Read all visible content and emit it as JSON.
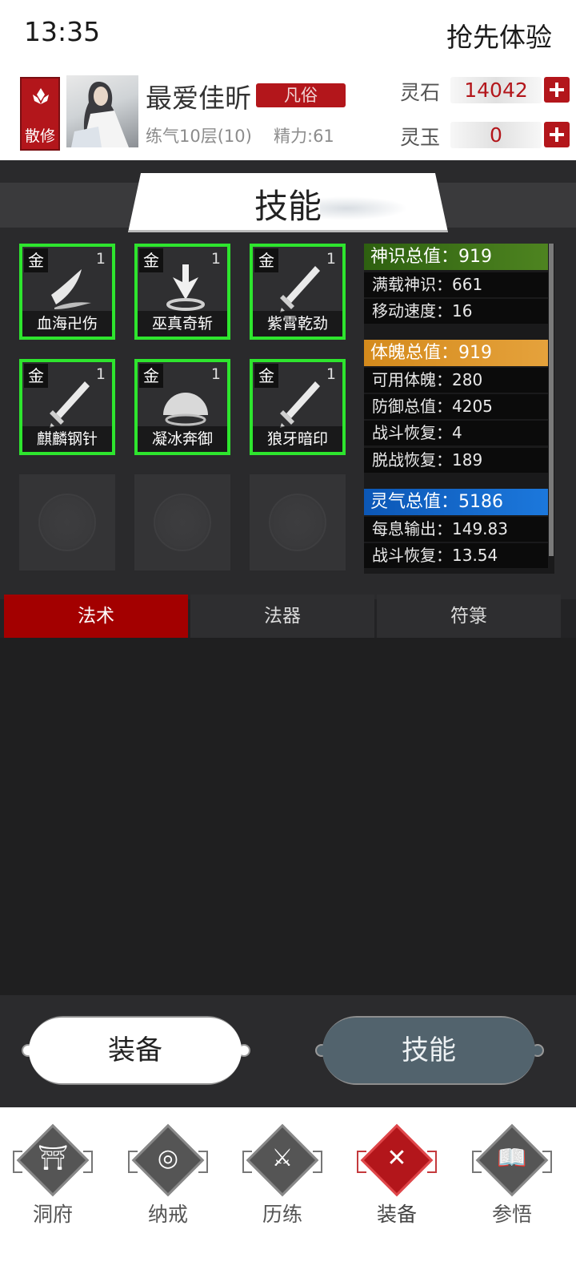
{
  "status": {
    "time": "13:35",
    "action": "抢先体验"
  },
  "player": {
    "sect": "散修",
    "name": "最爱佳昕",
    "rank": "凡俗",
    "realm": "练气10层(10)",
    "energy": "精力:61"
  },
  "currencies": [
    {
      "label": "灵石",
      "value": "14042"
    },
    {
      "label": "灵玉",
      "value": "0"
    }
  ],
  "panel": {
    "title": "技能"
  },
  "skills": [
    {
      "grade": "金",
      "level": "1",
      "name": "血海卍伤",
      "icon": "wave-slash-icon"
    },
    {
      "grade": "金",
      "level": "1",
      "name": "巫真奇斩",
      "icon": "arrow-down-icon"
    },
    {
      "grade": "金",
      "level": "1",
      "name": "紫霄乾劲",
      "icon": "sword-icon"
    },
    {
      "grade": "金",
      "level": "1",
      "name": "麒麟钢针",
      "icon": "sword-icon"
    },
    {
      "grade": "金",
      "level": "1",
      "name": "凝冰奔御",
      "icon": "shield-orb-icon"
    },
    {
      "grade": "金",
      "level": "1",
      "name": "狼牙暗印",
      "icon": "sword-icon"
    }
  ],
  "empty_slot_count": 3,
  "stats": {
    "groups": [
      {
        "header": "神识总值：919",
        "color": "#4e8420",
        "rows": [
          "满载神识：661",
          "移动速度：16"
        ]
      },
      {
        "header": "体魄总值：919",
        "color": "#e5a23c",
        "rows": [
          "可用体魄：280",
          "防御总值：4205",
          "战斗恢复：4",
          "脱战恢复：189"
        ]
      },
      {
        "header": "灵气总值：5186",
        "color": "#1c78dc",
        "rows": [
          "每息输出：149.83",
          "战斗恢复：13.54"
        ]
      }
    ]
  },
  "tabs": [
    {
      "label": "法术",
      "active": true
    },
    {
      "label": "法器",
      "active": false
    },
    {
      "label": "符箓",
      "active": false
    }
  ],
  "actions": {
    "equip_label": "装备",
    "skill_label": "技能"
  },
  "nav": [
    {
      "label": "洞府",
      "icon": "gate-icon",
      "active": false
    },
    {
      "label": "纳戒",
      "icon": "ring-icon",
      "active": false
    },
    {
      "label": "历练",
      "icon": "crossed-swords-icon",
      "active": false
    },
    {
      "label": "装备",
      "icon": "close-x-icon",
      "active": true
    },
    {
      "label": "参悟",
      "icon": "open-book-icon",
      "active": false
    }
  ],
  "colors": {
    "accent_red": "#b3161b",
    "slot_border": "#2ee52e",
    "tab_active": "#a30000"
  }
}
